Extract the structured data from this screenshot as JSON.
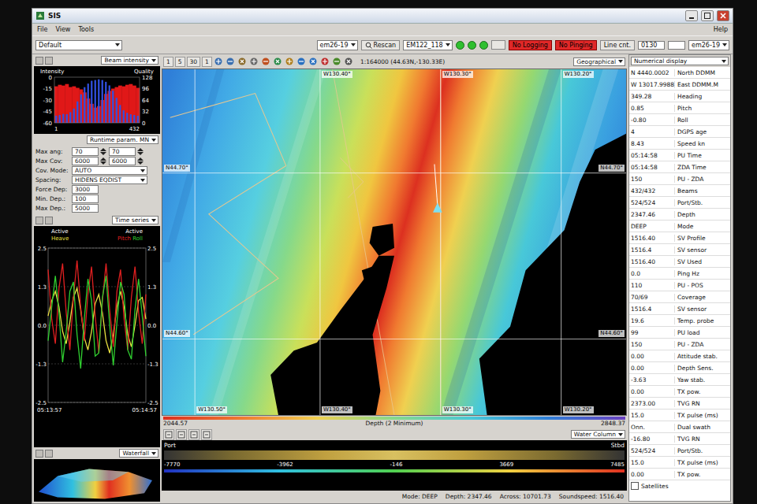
{
  "window": {
    "title": "SIS"
  },
  "menu": [
    {
      "label": "File"
    },
    {
      "label": "View"
    },
    {
      "label": "Tools"
    }
  ],
  "help": "Help",
  "toolbar": {
    "layout": "Default",
    "system": "em26-19",
    "rescan": "Rescan",
    "sounder": "EM122_118",
    "lights": [
      {
        "color": "#2fbf2f"
      },
      {
        "color": "#2fbf2f"
      },
      {
        "color": "#2fbf2f"
      }
    ],
    "alarms": [
      {
        "label": "No Logging",
        "on": true
      },
      {
        "label": "No Pinging",
        "on": true
      }
    ],
    "line_button": "Line cnt.",
    "line_count": "0130",
    "profile": "em26-19"
  },
  "beam_panel": {
    "view": "Beam intensity",
    "left_title": "Intensity",
    "right_title": "Quality",
    "left_ticks": [
      "0",
      "-15",
      "-30",
      "-45",
      "-60"
    ],
    "right_ticks": [
      "128",
      "96",
      "64",
      "32",
      "0"
    ],
    "x_start": "1",
    "x_end": "432",
    "intensity": [
      -12,
      -10,
      -11,
      -9,
      -13,
      -12,
      -14,
      -16,
      -20,
      -28,
      -35,
      -40,
      -38,
      -30,
      -22,
      -18,
      -15,
      -13,
      -11,
      -12,
      -10,
      -9,
      -11,
      -14
    ],
    "quality": [
      20,
      22,
      25,
      24,
      30,
      40,
      60,
      80,
      100,
      110,
      118,
      120,
      122,
      120,
      115,
      105,
      90,
      70,
      50,
      35,
      28,
      24,
      22,
      20
    ]
  },
  "runtime": {
    "view": "Runtime param. MN",
    "angle": {
      "label": "Max ang:",
      "port": "70",
      "stbd": "70"
    },
    "coverage": {
      "label": "Max Cov:",
      "port": "6000",
      "stbd": "6000"
    },
    "mode": {
      "label": "Cov. Mode:",
      "value": "AUTO"
    },
    "spacing": {
      "label": "Spacing:",
      "value": "HIDENS EQDIST"
    },
    "depths": [
      {
        "label": "Force Dep:",
        "value": "3000"
      },
      {
        "label": "Min. Dep.:",
        "value": "100"
      },
      {
        "label": "Max Dep.:",
        "value": "5000"
      }
    ]
  },
  "time_series": {
    "view": "Time series",
    "left_caption": "Active",
    "right_caption": "Active",
    "ticks_left": [
      "2.5",
      "1.3",
      "0.0",
      "-1.3",
      "-2.5"
    ],
    "ticks_right": [
      "2.5",
      "1.3",
      "0.0",
      "-1.3",
      "-2.5"
    ],
    "start_time": "05:13:57",
    "end_time": "05:14:57",
    "series": [
      {
        "name": "Heave",
        "color": "#e8e040",
        "values": [
          0.3,
          0.8,
          1.1,
          0.6,
          -0.2,
          -0.6,
          0.1,
          0.9,
          1.2,
          0.5,
          -0.4,
          -0.8,
          -0.2,
          0.7,
          1.0,
          0.4,
          -0.5,
          -0.9,
          -0.3,
          0.6,
          1.1,
          0.6,
          -0.3,
          -0.7,
          0.0,
          0.8,
          0.9,
          0.2
        ]
      },
      {
        "name": "Pitch",
        "color": "#e02020",
        "values": [
          1.8,
          0.2,
          -0.6,
          1.2,
          2.0,
          0.4,
          -0.8,
          0.9,
          2.1,
          0.6,
          -0.5,
          1.0,
          1.9,
          0.3,
          -0.9,
          0.8,
          2.0,
          0.5,
          -0.7,
          1.1,
          1.8,
          0.2,
          -0.8,
          0.9,
          1.9,
          0.4,
          -0.6,
          1.0
        ]
      },
      {
        "name": "Roll",
        "color": "#30d030",
        "values": [
          -0.5,
          0.6,
          1.6,
          0.4,
          -1.2,
          -0.2,
          1.1,
          1.4,
          -0.3,
          -1.4,
          0.2,
          1.5,
          0.8,
          -1.0,
          -0.9,
          0.9,
          1.6,
          0.0,
          -1.3,
          0.1,
          1.4,
          1.0,
          -0.8,
          -1.1,
          0.5,
          1.5,
          0.3,
          -1.0
        ]
      }
    ]
  },
  "waterfall": {
    "view": "Waterfall"
  },
  "map": {
    "view": "Geographical",
    "scale_buttons": [
      "1",
      "5",
      "30",
      "1"
    ],
    "scale": "1:164000 (44.63N,-130.33E)",
    "top_labels": [
      "W130.40°",
      "W130.30°",
      "W130.20°"
    ],
    "bottom_labels": [
      "W130.50°",
      "W130.40°",
      "W130.30°",
      "W130.20°"
    ],
    "left_labels": [
      "N44.70°",
      "N44.60°"
    ],
    "right_labels": [
      "N44.70°",
      "N44.60°"
    ],
    "depth_min": "2044.57",
    "depth_max": "2848.37",
    "depth_caption": "Depth (2 Minimum)"
  },
  "water_column": {
    "view": "Water Column",
    "port": "Port",
    "stbd": "Stbd",
    "ticks": [
      "-7770",
      "-3962",
      "-146",
      "3669",
      "7485"
    ]
  },
  "status_bar": [
    {
      "label": "Mode:",
      "value": "DEEP"
    },
    {
      "label": "Depth:",
      "value": "2347.46"
    },
    {
      "label": "Across:",
      "value": "10701.73"
    },
    {
      "label": "Soundspeed:",
      "value": "1516.40"
    }
  ],
  "numerical": {
    "view": "Numerical display",
    "rows": [
      {
        "value": "N 4440.0002",
        "label": "North DDMM"
      },
      {
        "value": "W 13017.9988",
        "label": "East DDMM.M"
      },
      {
        "value": "349.28",
        "label": "Heading"
      },
      {
        "value": "0.85",
        "label": "Pitch"
      },
      {
        "value": "-0.80",
        "label": "Roll"
      },
      {
        "value": "4",
        "label": "DGPS age"
      },
      {
        "value": "8.43",
        "label": "Speed kn"
      },
      {
        "value": "05:14:58",
        "label": "PU Time"
      },
      {
        "value": "05:14:58",
        "label": "ZDA Time"
      },
      {
        "value": "150",
        "label": "PU - ZDA"
      },
      {
        "value": "432/432",
        "label": "Beams"
      },
      {
        "value": "524/524",
        "label": "Port/Stb."
      },
      {
        "value": "2347.46",
        "label": "Depth"
      },
      {
        "value": "DEEP",
        "label": "Mode"
      },
      {
        "value": "1516.40",
        "label": "SV Profile"
      },
      {
        "value": "1516.4",
        "label": "SV sensor"
      },
      {
        "value": "1516.40",
        "label": "SV Used"
      },
      {
        "value": "0.0",
        "label": "Ping Hz"
      },
      {
        "value": "110",
        "label": "PU - POS"
      },
      {
        "value": "70/69",
        "label": "Coverage"
      },
      {
        "value": "1516.4",
        "label": "SV sensor"
      },
      {
        "value": "19.6",
        "label": "Temp. probe"
      },
      {
        "value": "99",
        "label": "PU load"
      },
      {
        "value": "150",
        "label": "PU - ZDA"
      },
      {
        "value": "0.00",
        "label": "Attitude stab."
      },
      {
        "value": "0.00",
        "label": "Depth Sens."
      },
      {
        "value": "-3.63",
        "label": "Yaw stab."
      },
      {
        "value": "0.00",
        "label": "TX pow."
      },
      {
        "value": "2373.00",
        "label": "TVG RN"
      },
      {
        "value": "15.0",
        "label": "TX pulse (ms)"
      },
      {
        "value": "Onn.",
        "label": "Dual swath"
      },
      {
        "value": "-16.80",
        "label": "TVG RN"
      },
      {
        "value": "524/524",
        "label": "Port/Stb."
      },
      {
        "value": "15.0",
        "label": "TX pulse (ms)"
      },
      {
        "value": "0.00",
        "label": "TX pow."
      }
    ],
    "satellites": {
      "label": "Satellites",
      "checked": false
    }
  }
}
